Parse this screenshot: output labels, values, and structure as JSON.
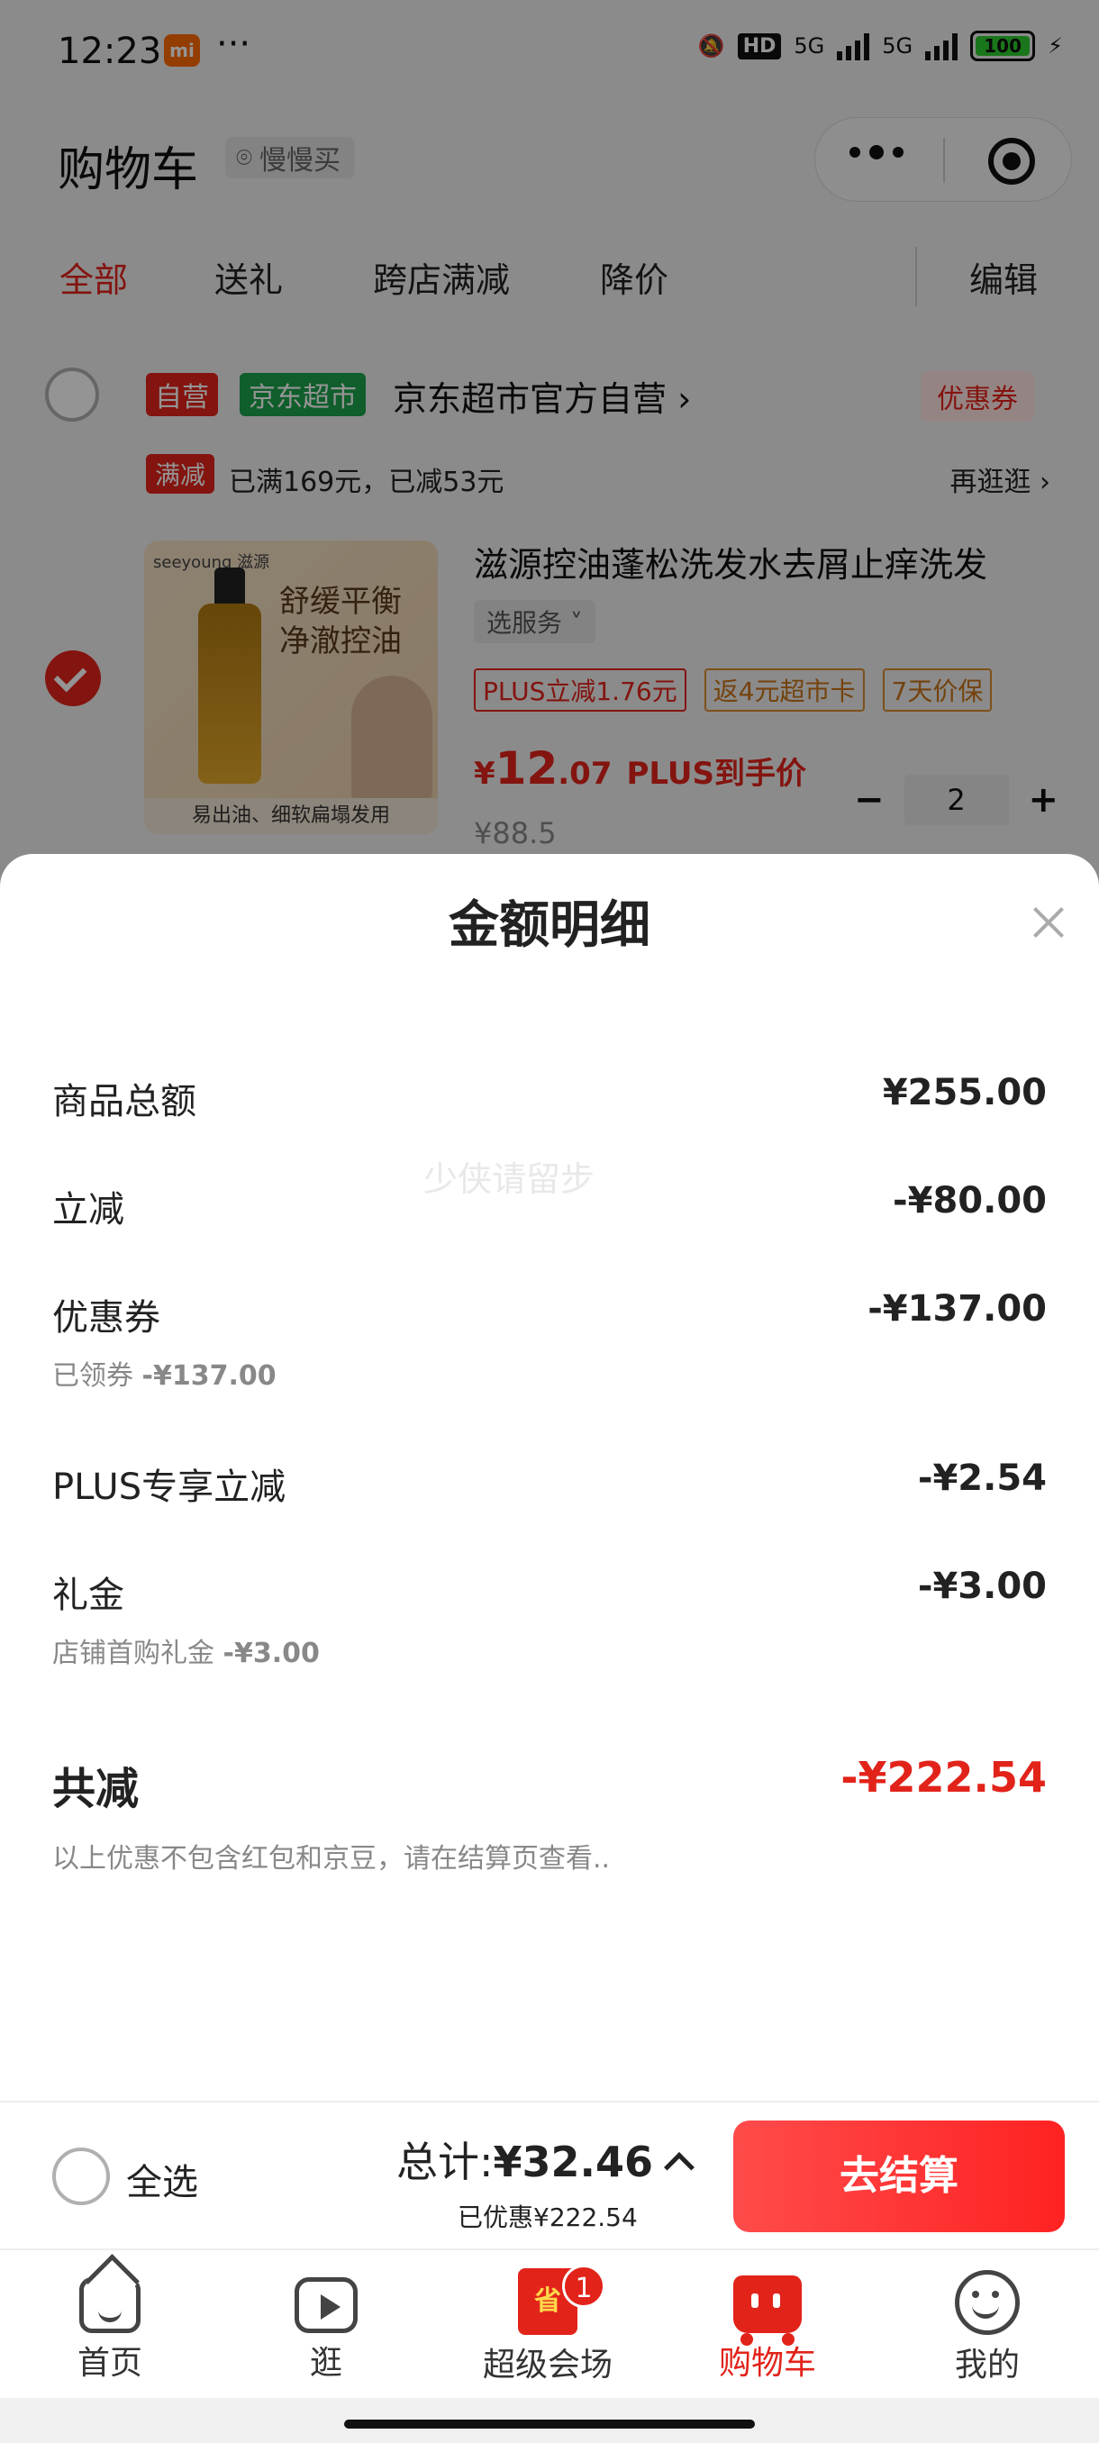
{
  "status_bar": {
    "time": "12:23",
    "app_badge": "mi",
    "more": "···",
    "hd_label": "HD",
    "net1": "5G",
    "net2": "5G",
    "battery": "100"
  },
  "header": {
    "title": "购物车",
    "location": "慢慢买"
  },
  "tabs": [
    "全部",
    "送礼",
    "跨店满减",
    "降价"
  ],
  "edit_label": "编辑",
  "store": {
    "tag_self": "自营",
    "tag_market": "京东超市",
    "name": "京东超市官方自营",
    "coupon": "优惠券",
    "promo_tag": "满减",
    "promo_text": "已满169元，已减53元",
    "promo_more": "再逛逛"
  },
  "product": {
    "name": "滋源控油蓬松洗发水去屑止痒洗发",
    "service": "选服务",
    "chips": [
      "PLUS立减1.76元",
      "返4元超市卡",
      "7天价保"
    ],
    "price_symbol": "¥",
    "price_int": "12",
    "price_dec": ".07",
    "price_label": "PLUS到手价",
    "old_price": "¥88.5",
    "quantity": "2",
    "image_caption": "易出油、细软扁塌发用",
    "image_headline": "舒缓平衡 净澈控油",
    "image_brand": "seeyoung 滋源"
  },
  "sheet": {
    "title": "金额明细",
    "watermark": "少侠请留步",
    "lines": [
      {
        "label": "商品总额",
        "value": "¥255.00"
      },
      {
        "label": "立减",
        "value": "-¥80.00"
      },
      {
        "label": "优惠券",
        "value": "-¥137.00",
        "sub_label": "已领券",
        "sub_value": "-¥137.00"
      },
      {
        "label": "PLUS专享立减",
        "value": "-¥2.54"
      },
      {
        "label": "礼金",
        "value": "-¥3.00",
        "sub_label": "店铺首购礼金",
        "sub_value": "-¥3.00"
      }
    ],
    "total_label": "共减",
    "total_value": "-¥222.54",
    "note": "以上优惠不包含红包和京豆，请在结算页查看.."
  },
  "checkout": {
    "select_all": "全选",
    "total_label": "总计:",
    "total_value": "¥32.46",
    "saved_label": "已优惠",
    "saved_value": "¥222.54",
    "button": "去结算"
  },
  "tabbar": {
    "items": [
      {
        "label": "首页",
        "icon": "home-icon"
      },
      {
        "label": "逛",
        "icon": "play-icon"
      },
      {
        "label": "超级会场",
        "icon": "super-venue-icon",
        "icon_text": "省"
      },
      {
        "label": "购物车",
        "icon": "cart-icon"
      },
      {
        "label": "我的",
        "icon": "profile-icon"
      }
    ],
    "badge": "1",
    "active_index": 3
  },
  "colors": {
    "accent": "#e2231a",
    "market_green": "#1aa34a",
    "chip_orange": "#c97318"
  }
}
